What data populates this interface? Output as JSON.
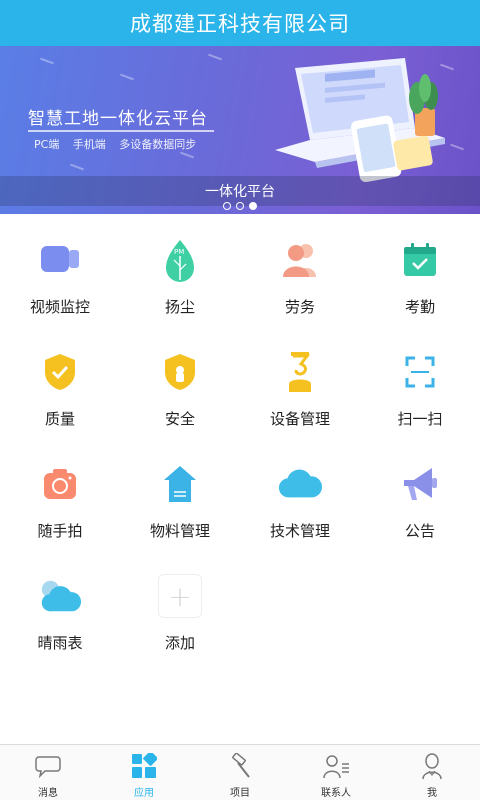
{
  "header": {
    "title": "成都建正科技有限公司"
  },
  "banner": {
    "headline": "智慧工地一体化云平台",
    "subline": "PC端 手机端 多设备数据同步",
    "caption": "一体化平台",
    "page_count": 3,
    "active_page": 3
  },
  "apps": [
    {
      "label": "视频监控",
      "icon": "video-camera-icon"
    },
    {
      "label": "扬尘",
      "icon": "leaf-pm-icon"
    },
    {
      "label": "劳务",
      "icon": "people-icon"
    },
    {
      "label": "考勤",
      "icon": "calendar-check-icon"
    },
    {
      "label": "质量",
      "icon": "shield-check-icon"
    },
    {
      "label": "安全",
      "icon": "shield-lock-icon"
    },
    {
      "label": "设备管理",
      "icon": "crane-hook-icon"
    },
    {
      "label": "扫一扫",
      "icon": "scan-icon"
    },
    {
      "label": "随手拍",
      "icon": "camera-icon"
    },
    {
      "label": "物料管理",
      "icon": "warehouse-icon"
    },
    {
      "label": "技术管理",
      "icon": "cloud-icon"
    },
    {
      "label": "公告",
      "icon": "megaphone-icon"
    },
    {
      "label": "晴雨表",
      "icon": "weather-icon"
    },
    {
      "label": "添加",
      "icon": "plus-icon"
    }
  ],
  "tabbar": {
    "items": [
      {
        "label": "消息",
        "icon": "chat-bubble-icon"
      },
      {
        "label": "应用",
        "icon": "apps-grid-icon",
        "active": true
      },
      {
        "label": "项目",
        "icon": "hammer-icon"
      },
      {
        "label": "联系人",
        "icon": "contact-list-icon"
      },
      {
        "label": "我",
        "icon": "user-icon"
      }
    ]
  },
  "colors": {
    "primary": "#2bb4e9",
    "banner_start": "#5a7ee6",
    "banner_end": "#6b52c8"
  }
}
